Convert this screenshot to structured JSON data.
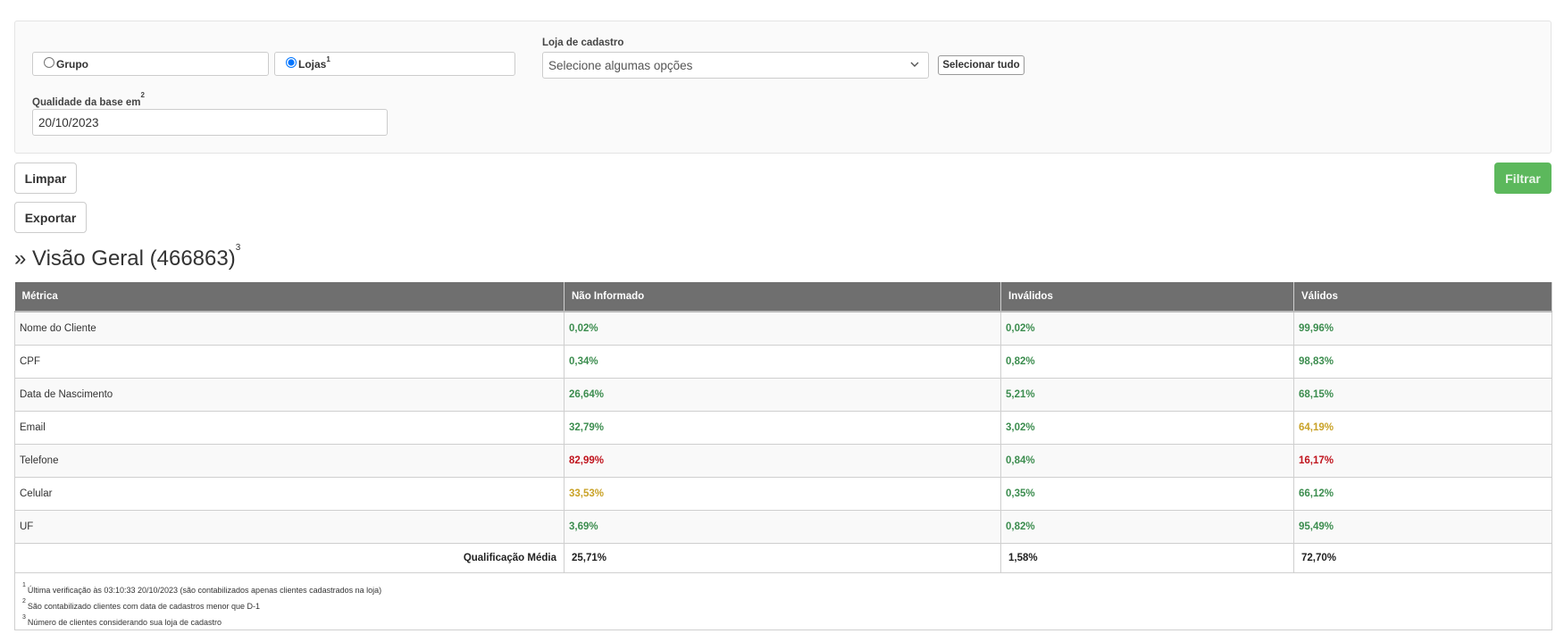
{
  "filters": {
    "radio_grupo_label": "Grupo",
    "radio_lojas_label": "Lojas",
    "radio_lojas_footnote": "1",
    "selected_radio": "lojas",
    "loja_label": "Loja de cadastro",
    "loja_placeholder": "Selecione algumas opções",
    "select_all_label": "Selecionar tudo",
    "date_label": "Qualidade da base em",
    "date_footnote": "2",
    "date_value": "20/10/2023"
  },
  "actions": {
    "clear_label": "Limpar",
    "export_label": "Exportar",
    "filter_label": "Filtrar"
  },
  "overview": {
    "title": "» Visão Geral (466863)",
    "footnote": "3"
  },
  "table": {
    "columns": [
      "Métrica",
      "Não Informado",
      "Inválidos",
      "Válidos"
    ],
    "rows": [
      {
        "metric": "Nome do Cliente",
        "nao_informado": "0,02%",
        "nao_informado_color": "green",
        "invalidos": "0,02%",
        "invalidos_color": "green",
        "validos": "99,96%",
        "validos_color": "green"
      },
      {
        "metric": "CPF",
        "nao_informado": "0,34%",
        "nao_informado_color": "green",
        "invalidos": "0,82%",
        "invalidos_color": "green",
        "validos": "98,83%",
        "validos_color": "green"
      },
      {
        "metric": "Data de Nascimento",
        "nao_informado": "26,64%",
        "nao_informado_color": "green",
        "invalidos": "5,21%",
        "invalidos_color": "green",
        "validos": "68,15%",
        "validos_color": "green"
      },
      {
        "metric": "Email",
        "nao_informado": "32,79%",
        "nao_informado_color": "green",
        "invalidos": "3,02%",
        "invalidos_color": "green",
        "validos": "64,19%",
        "validos_color": "yellow"
      },
      {
        "metric": "Telefone",
        "nao_informado": "82,99%",
        "nao_informado_color": "red",
        "invalidos": "0,84%",
        "invalidos_color": "green",
        "validos": "16,17%",
        "validos_color": "red"
      },
      {
        "metric": "Celular",
        "nao_informado": "33,53%",
        "nao_informado_color": "yellow",
        "invalidos": "0,35%",
        "invalidos_color": "green",
        "validos": "66,12%",
        "validos_color": "green"
      },
      {
        "metric": "UF",
        "nao_informado": "3,69%",
        "nao_informado_color": "green",
        "invalidos": "0,82%",
        "invalidos_color": "green",
        "validos": "95,49%",
        "validos_color": "green"
      }
    ],
    "summary": {
      "label": "Qualificação Média",
      "nao_informado": "25,71%",
      "invalidos": "1,58%",
      "validos": "72,70%"
    },
    "footnotes": [
      {
        "mark": "1",
        "text": "Última verificação às 03:10:33 20/10/2023 (são contabilizados apenas clientes cadastrados na loja)"
      },
      {
        "mark": "2",
        "text": "São contabilizado clientes com data de cadastros menor que D-1"
      },
      {
        "mark": "3",
        "text": "Número de clientes considerando sua loja de cadastro"
      }
    ]
  },
  "colors": {
    "green": "#3c8d4f",
    "yellow": "#c9a227",
    "red": "#c0141d",
    "header_bg": "#6f6f6f",
    "filter_button": "#5cb85c"
  }
}
